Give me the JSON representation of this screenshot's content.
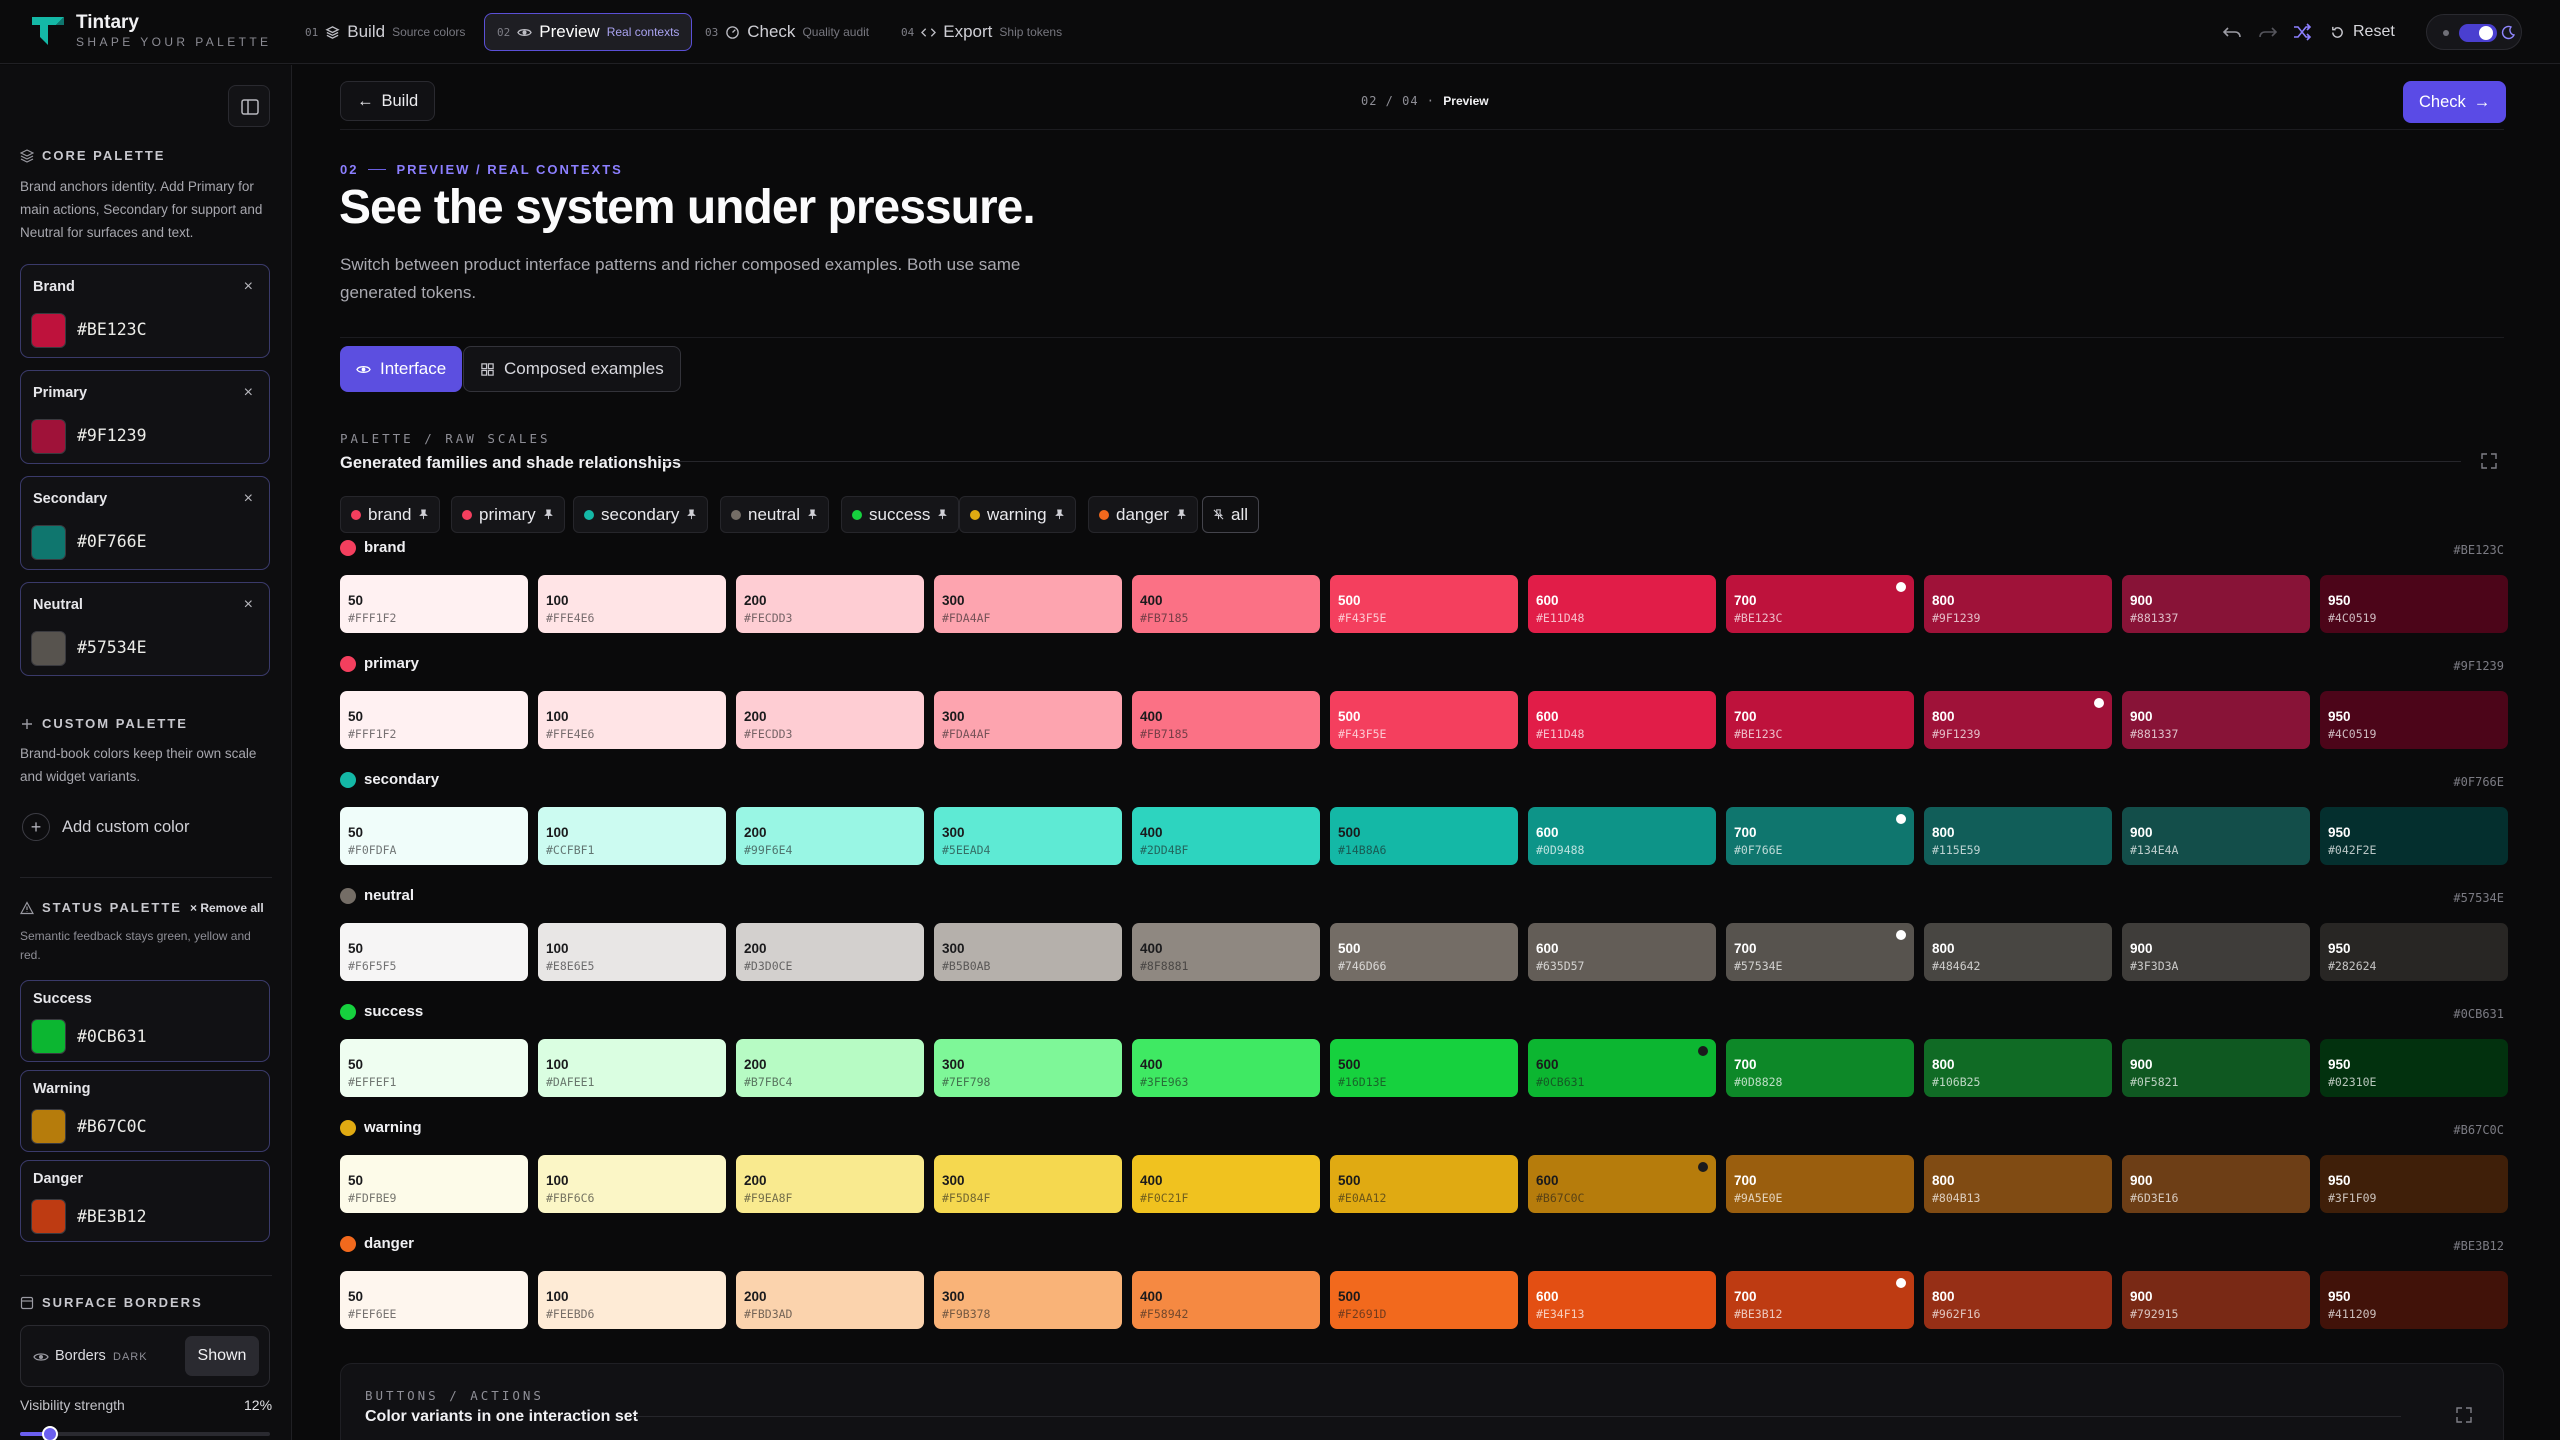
{
  "app": {
    "name": "Tintary",
    "tagline": "SHAPE YOUR PALETTE"
  },
  "steps": [
    {
      "num": "01",
      "title": "Build",
      "sub": "Source colors",
      "icon": "layers-icon"
    },
    {
      "num": "02",
      "title": "Preview",
      "sub": "Real contexts",
      "icon": "eye-icon",
      "active": true
    },
    {
      "num": "03",
      "title": "Check",
      "sub": "Quality audit",
      "icon": "gauge-icon"
    },
    {
      "num": "04",
      "title": "Export",
      "sub": "Ship tokens",
      "icon": "code-icon"
    }
  ],
  "toolbar": {
    "reset_label": "Reset",
    "theme": "dark"
  },
  "sidebar": {
    "core": {
      "heading": "CORE PALETTE",
      "desc": "Brand anchors identity. Add Primary for main actions, Secondary for support and Neutral for surfaces and text.",
      "colors": [
        {
          "label": "Brand",
          "hex": "#BE123C",
          "remove": "×"
        },
        {
          "label": "Primary",
          "hex": "#9F1239",
          "remove": "×"
        },
        {
          "label": "Secondary",
          "hex": "#0F766E",
          "remove": "×"
        },
        {
          "label": "Neutral",
          "hex": "#57534E",
          "remove": "×"
        }
      ]
    },
    "custom": {
      "heading": "CUSTOM PALETTE",
      "desc": "Brand-book colors keep their own scale and widget variants.",
      "add_label": "Add custom color"
    },
    "status": {
      "heading": "STATUS PALETTE",
      "remove_all": "Remove all",
      "desc": "Semantic feedback stays green, yellow and red.",
      "colors": [
        {
          "label": "Success",
          "hex": "#0CB631"
        },
        {
          "label": "Warning",
          "hex": "#B67C0C"
        },
        {
          "label": "Danger",
          "hex": "#BE3B12"
        }
      ]
    },
    "borders": {
      "heading": "SURFACE BORDERS",
      "label": "Borders",
      "mode": "DARK",
      "state": "Shown",
      "visibility_label": "Visibility strength",
      "visibility_value": "12%",
      "visibility_fraction": 0.12
    }
  },
  "main": {
    "back_label": "Build",
    "crumb_pos": "02 / 04 ·",
    "crumb_name": "Preview",
    "next_label": "Check",
    "eyebrow_num": "02",
    "eyebrow_text": "PREVIEW / REAL CONTEXTS",
    "title": "See the system under pressure.",
    "lead": "Switch between product interface patterns and richer composed examples. Both use same generated tokens.",
    "tabs": [
      {
        "label": "Interface",
        "active": true
      },
      {
        "label": "Composed examples",
        "active": false
      }
    ],
    "palette_section": {
      "eyebrow": "PALETTE / RAW SCALES",
      "title": "Generated families and shade relationships"
    },
    "filters": [
      {
        "label": "brand",
        "color": "#F43F5E"
      },
      {
        "label": "primary",
        "color": "#F43F5E"
      },
      {
        "label": "secondary",
        "color": "#14B8A6"
      },
      {
        "label": "neutral",
        "color": "#746D66"
      },
      {
        "label": "success",
        "color": "#16D13E"
      },
      {
        "label": "warning",
        "color": "#E0AA12"
      },
      {
        "label": "danger",
        "color": "#F2691D"
      }
    ],
    "filter_all": "all",
    "steps": [
      "50",
      "100",
      "200",
      "300",
      "400",
      "500",
      "600",
      "700",
      "800",
      "900",
      "950"
    ],
    "families": [
      {
        "name": "brand",
        "base": "#BE123C",
        "dot": "#F43F5E",
        "marker": 7,
        "hexes": [
          "#FFF1F2",
          "#FFE4E6",
          "#FECDD3",
          "#FDA4AF",
          "#FB7185",
          "#F43F5E",
          "#E11D48",
          "#BE123C",
          "#9F1239",
          "#881337",
          "#4C0519"
        ]
      },
      {
        "name": "primary",
        "base": "#9F1239",
        "dot": "#F43F5E",
        "marker": 8,
        "hexes": [
          "#FFF1F2",
          "#FFE4E6",
          "#FECDD3",
          "#FDA4AF",
          "#FB7185",
          "#F43F5E",
          "#E11D48",
          "#BE123C",
          "#9F1239",
          "#881337",
          "#4C0519"
        ]
      },
      {
        "name": "secondary",
        "base": "#0F766E",
        "dot": "#14B8A6",
        "marker": 7,
        "hexes": [
          "#F0FDFA",
          "#CCFBF1",
          "#99F6E4",
          "#5EEAD4",
          "#2DD4BF",
          "#14B8A6",
          "#0D9488",
          "#0F766E",
          "#115E59",
          "#134E4A",
          "#042F2E"
        ]
      },
      {
        "name": "neutral",
        "base": "#57534E",
        "dot": "#746D66",
        "marker": 7,
        "hexes": [
          "#F6F5F5",
          "#E8E6E5",
          "#D3D0CE",
          "#B5B0AB",
          "#8F8881",
          "#746D66",
          "#635D57",
          "#57534E",
          "#484642",
          "#3F3D3A",
          "#282624"
        ]
      },
      {
        "name": "success",
        "base": "#0CB631",
        "dot": "#16D13E",
        "marker": 6,
        "hexes": [
          "#EFFEF1",
          "#DAFEE1",
          "#B7FBC4",
          "#7EF798",
          "#3FE963",
          "#16D13E",
          "#0CB631",
          "#0D8828",
          "#106B25",
          "#0F5821",
          "#02310E"
        ]
      },
      {
        "name": "warning",
        "base": "#B67C0C",
        "dot": "#E0AA12",
        "marker": 6,
        "hexes": [
          "#FDFBE9",
          "#FBF6C6",
          "#F9EA8F",
          "#F5D84F",
          "#F0C21F",
          "#E0AA12",
          "#B67C0C",
          "#9A5E0E",
          "#804B13",
          "#6D3E16",
          "#3F1F09"
        ]
      },
      {
        "name": "danger",
        "base": "#BE3B12",
        "dot": "#F2691D",
        "marker": 7,
        "hexes": [
          "#FEF6EE",
          "#FEEBD6",
          "#FBD3AD",
          "#F9B378",
          "#F58942",
          "#F2691D",
          "#E34F13",
          "#BE3B12",
          "#962F16",
          "#792915",
          "#411209"
        ]
      }
    ],
    "actions_section": {
      "eyebrow": "BUTTONS / ACTIONS",
      "title": "Color variants in one interaction set"
    }
  },
  "colors": {
    "accent": "#5C4FE0",
    "accent_light": "#8C7FFF",
    "background": "#0A0A0B"
  }
}
